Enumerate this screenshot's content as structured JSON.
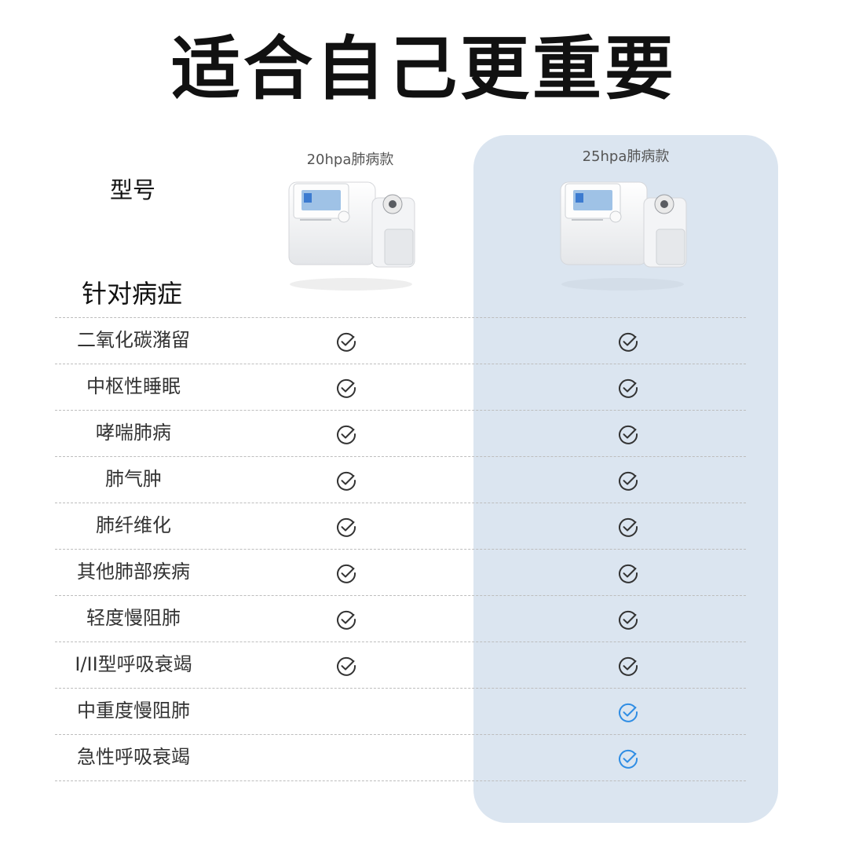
{
  "title": "适合自己更重要",
  "labels": {
    "model": "型号",
    "target_disease": "针对病症"
  },
  "models": [
    {
      "name": "20hpa肺病款"
    },
    {
      "name": "25hpa肺病款"
    }
  ],
  "icons": {
    "check": "check-circle-icon"
  },
  "colors": {
    "panel": "#dbe5f0",
    "check_default": "#333333",
    "check_highlight": "#2f8de4"
  },
  "rows": [
    {
      "name": "二氧化碳潴留",
      "m1": true,
      "m2": true,
      "m2_highlight": false
    },
    {
      "name": "中枢性睡眠",
      "m1": true,
      "m2": true,
      "m2_highlight": false
    },
    {
      "name": "哮喘肺病",
      "m1": true,
      "m2": true,
      "m2_highlight": false
    },
    {
      "name": "肺气肿",
      "m1": true,
      "m2": true,
      "m2_highlight": false
    },
    {
      "name": "肺纤维化",
      "m1": true,
      "m2": true,
      "m2_highlight": false
    },
    {
      "name": "其他肺部疾病",
      "m1": true,
      "m2": true,
      "m2_highlight": false
    },
    {
      "name": "轻度慢阻肺",
      "m1": true,
      "m2": true,
      "m2_highlight": false
    },
    {
      "name": "I/II型呼吸衰竭",
      "m1": true,
      "m2": true,
      "m2_highlight": false
    },
    {
      "name": "中重度慢阻肺",
      "m1": false,
      "m2": true,
      "m2_highlight": true
    },
    {
      "name": "急性呼吸衰竭",
      "m1": false,
      "m2": true,
      "m2_highlight": true
    }
  ]
}
